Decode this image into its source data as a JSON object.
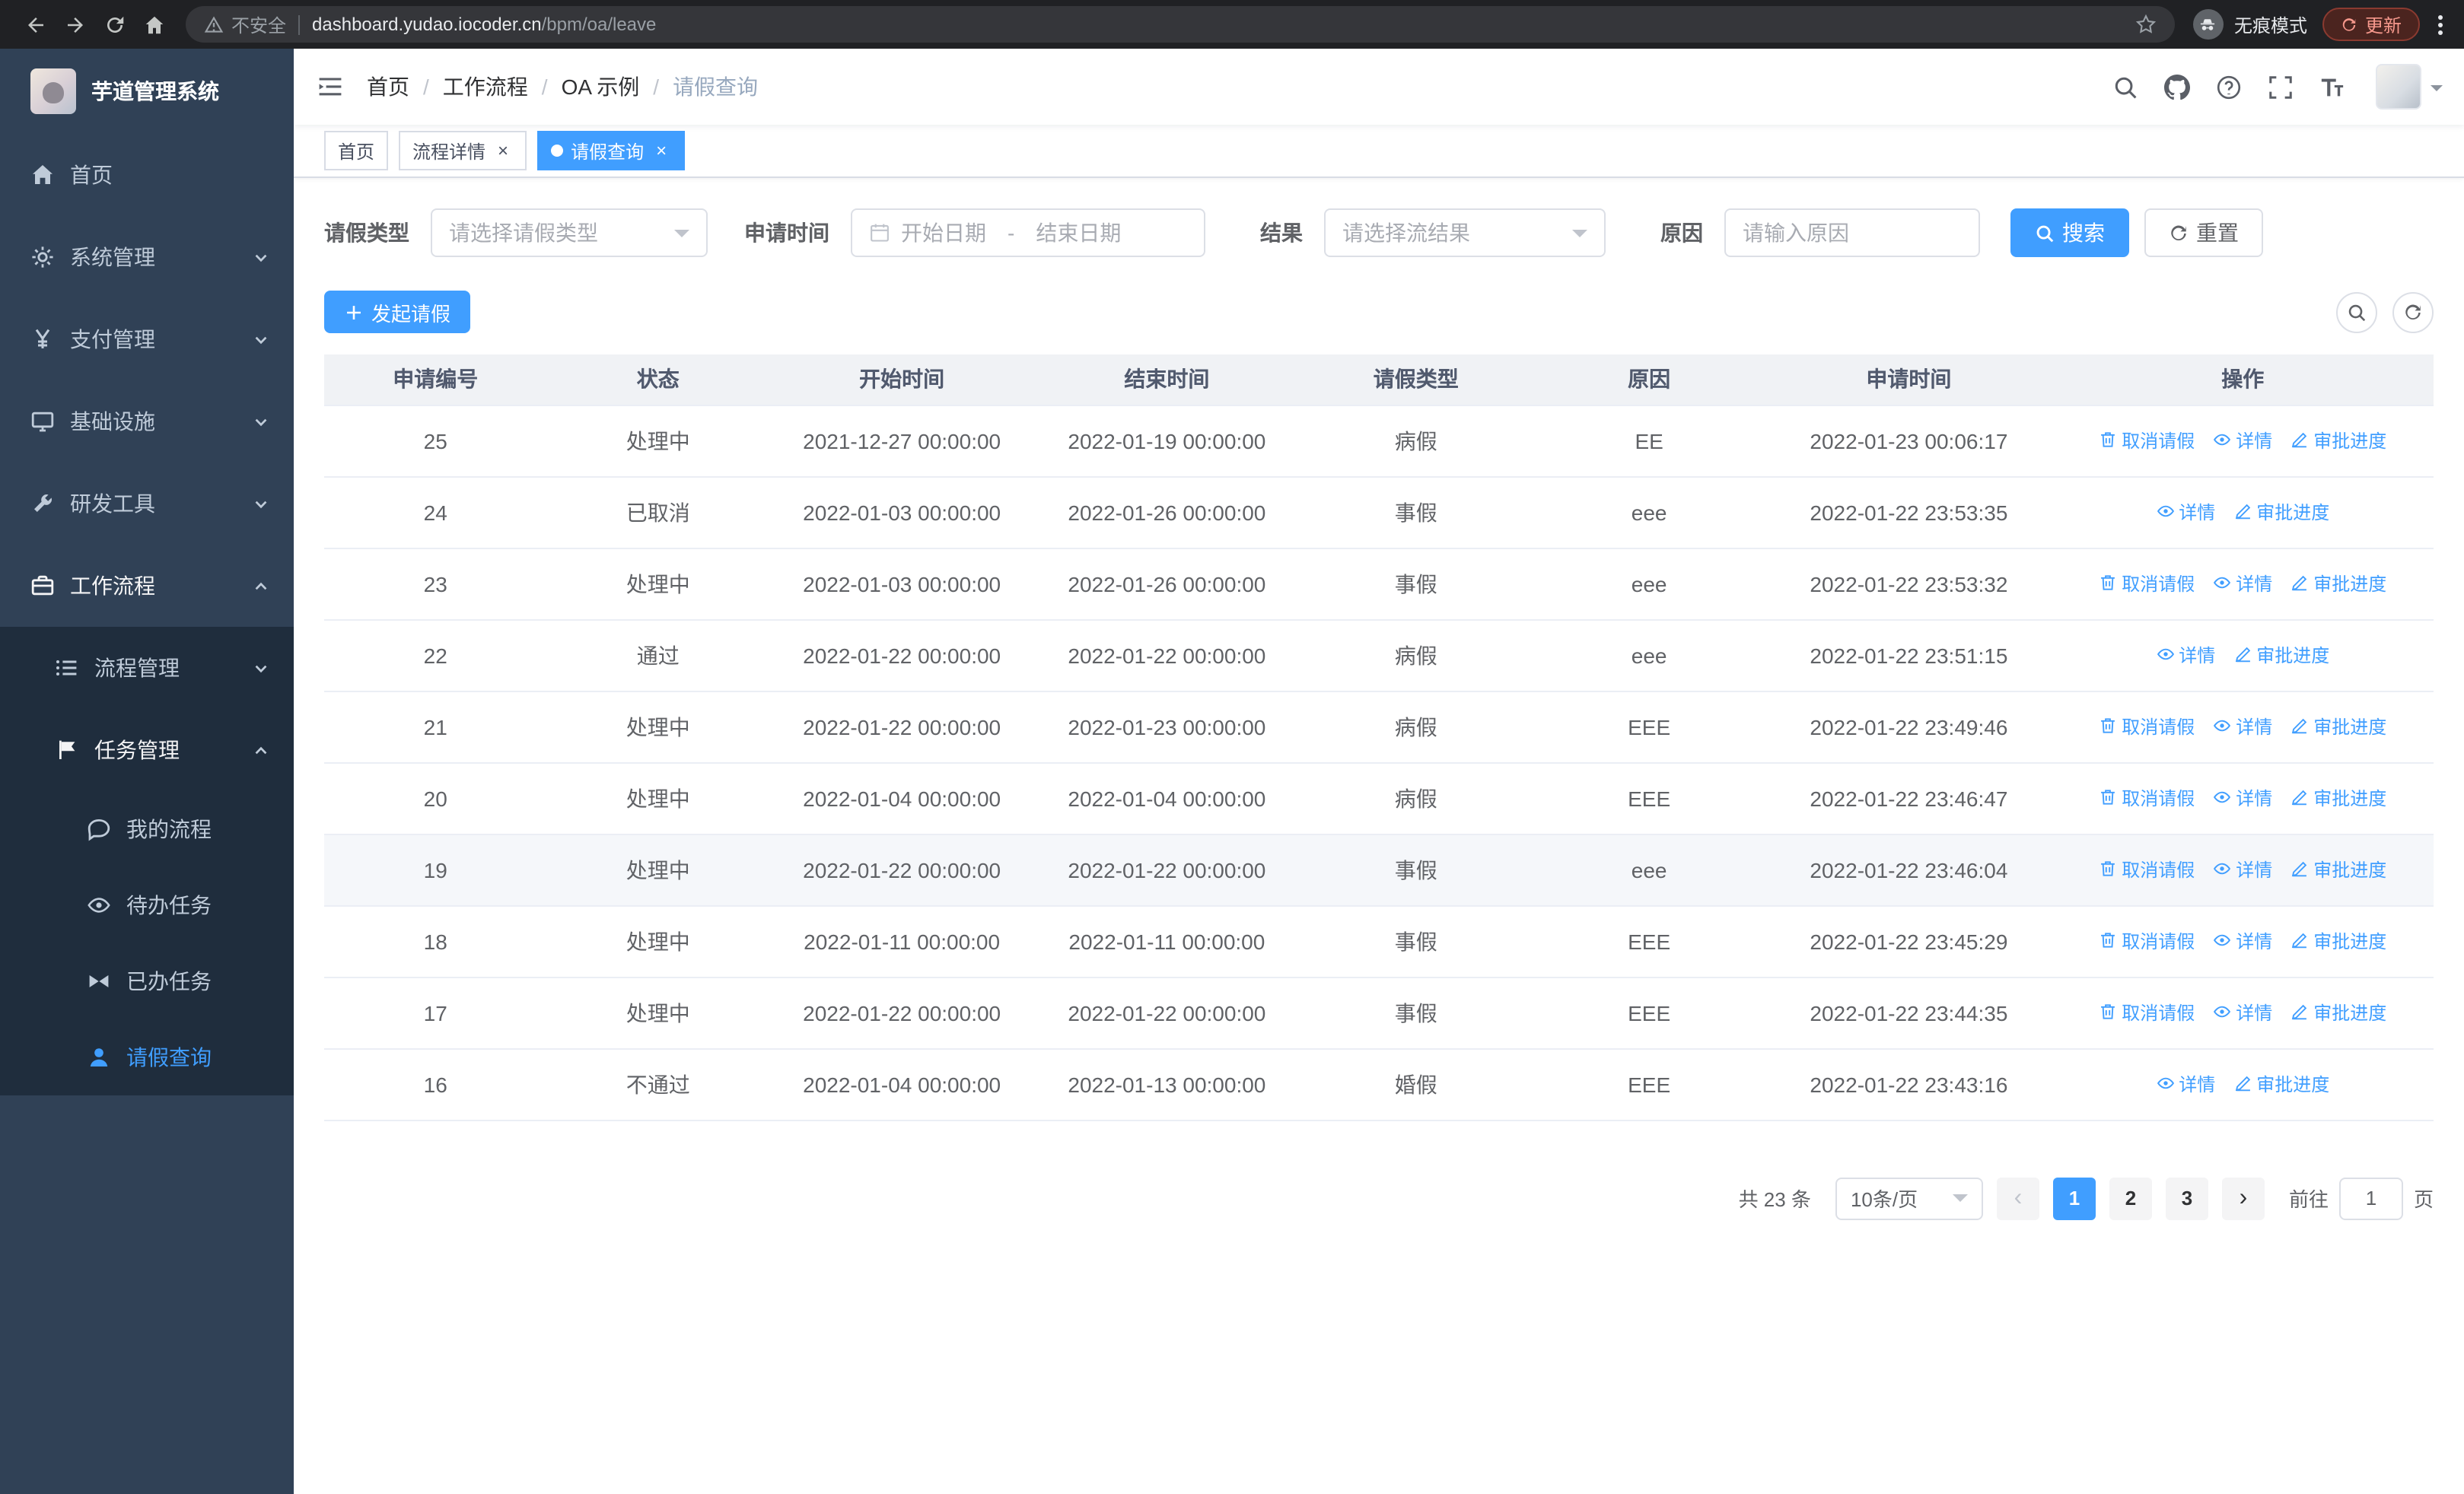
{
  "browser": {
    "security_label": "不安全",
    "url_domain": "dashboard.yudao.iocoder.cn",
    "url_path": "/bpm/oa/leave",
    "incognito_label": "无痕模式",
    "update_label": "更新"
  },
  "sidebar": {
    "title": "芋道管理系统",
    "items": [
      {
        "key": "home",
        "label": "首页",
        "icon": "home-icon",
        "level": 1,
        "expandable": false,
        "expanded": false,
        "sub": false,
        "active": false,
        "active_trail": false
      },
      {
        "key": "system",
        "label": "系统管理",
        "icon": "gear-icon",
        "level": 1,
        "expandable": true,
        "expanded": false,
        "sub": false,
        "active": false,
        "active_trail": false
      },
      {
        "key": "payment",
        "label": "支付管理",
        "icon": "yen-icon",
        "level": 1,
        "expandable": true,
        "expanded": false,
        "sub": false,
        "active": false,
        "active_trail": false
      },
      {
        "key": "infra",
        "label": "基础设施",
        "icon": "monitor-icon",
        "level": 1,
        "expandable": true,
        "expanded": false,
        "sub": false,
        "active": false,
        "active_trail": false
      },
      {
        "key": "devtools",
        "label": "研发工具",
        "icon": "tools-icon",
        "level": 1,
        "expandable": true,
        "expanded": false,
        "sub": false,
        "active": false,
        "active_trail": false
      },
      {
        "key": "workflow",
        "label": "工作流程",
        "icon": "briefcase-icon",
        "level": 1,
        "expandable": true,
        "expanded": true,
        "sub": false,
        "active": false,
        "active_trail": true
      },
      {
        "key": "process-mgmt",
        "label": "流程管理",
        "icon": "list-icon",
        "level": 2,
        "expandable": true,
        "expanded": false,
        "sub": true,
        "active": false,
        "active_trail": false
      },
      {
        "key": "task-mgmt",
        "label": "任务管理",
        "icon": "flag-icon",
        "level": 2,
        "expandable": true,
        "expanded": true,
        "sub": true,
        "active": false,
        "active_trail": true
      },
      {
        "key": "my-process",
        "label": "我的流程",
        "icon": "chat-icon",
        "level": 3,
        "expandable": false,
        "expanded": false,
        "sub": true,
        "active": false,
        "active_trail": false
      },
      {
        "key": "todo-tasks",
        "label": "待办任务",
        "icon": "eye-icon",
        "level": 3,
        "expandable": false,
        "expanded": false,
        "sub": true,
        "active": false,
        "active_trail": false
      },
      {
        "key": "done-tasks",
        "label": "已办任务",
        "icon": "bowtie-icon",
        "level": 3,
        "expandable": false,
        "expanded": false,
        "sub": true,
        "active": false,
        "active_trail": false
      },
      {
        "key": "leave-query",
        "label": "请假查询",
        "icon": "user-icon",
        "level": 3,
        "expandable": false,
        "expanded": false,
        "sub": true,
        "active": true,
        "active_trail": false
      }
    ]
  },
  "header": {
    "breadcrumb": [
      "首页",
      "工作流程",
      "OA 示例",
      "请假查询"
    ]
  },
  "tabs": [
    {
      "key": "home",
      "label": "首页",
      "closable": false,
      "active": false
    },
    {
      "key": "process-detail",
      "label": "流程详情",
      "closable": true,
      "active": false
    },
    {
      "key": "leave-query",
      "label": "请假查询",
      "closable": true,
      "active": true
    }
  ],
  "filters": {
    "leave_type_label": "请假类型",
    "leave_type_placeholder": "请选择请假类型",
    "apply_time_label": "申请时间",
    "start_date_placeholder": "开始日期",
    "range_separator": "-",
    "end_date_placeholder": "结束日期",
    "result_label": "结果",
    "result_placeholder": "请选择流结果",
    "reason_label": "原因",
    "reason_placeholder": "请输入原因",
    "search_button": "搜索",
    "reset_button": "重置"
  },
  "toolbar": {
    "create_button": "发起请假"
  },
  "table": {
    "columns": [
      "申请编号",
      "状态",
      "开始时间",
      "结束时间",
      "请假类型",
      "原因",
      "申请时间",
      "操作"
    ],
    "actions": {
      "cancel": "取消请假",
      "detail": "详情",
      "progress": "审批进度"
    },
    "rows": [
      {
        "id": "25",
        "status": "处理中",
        "start": "2021-12-27 00:00:00",
        "end": "2022-01-19 00:00:00",
        "type": "病假",
        "reason": "EE",
        "applied": "2022-01-23 00:06:17",
        "actions": [
          "cancel",
          "detail",
          "progress"
        ],
        "highlight": false
      },
      {
        "id": "24",
        "status": "已取消",
        "start": "2022-01-03 00:00:00",
        "end": "2022-01-26 00:00:00",
        "type": "事假",
        "reason": "eee",
        "applied": "2022-01-22 23:53:35",
        "actions": [
          "detail",
          "progress"
        ],
        "highlight": false
      },
      {
        "id": "23",
        "status": "处理中",
        "start": "2022-01-03 00:00:00",
        "end": "2022-01-26 00:00:00",
        "type": "事假",
        "reason": "eee",
        "applied": "2022-01-22 23:53:32",
        "actions": [
          "cancel",
          "detail",
          "progress"
        ],
        "highlight": false
      },
      {
        "id": "22",
        "status": "通过",
        "start": "2022-01-22 00:00:00",
        "end": "2022-01-22 00:00:00",
        "type": "病假",
        "reason": "eee",
        "applied": "2022-01-22 23:51:15",
        "actions": [
          "detail",
          "progress"
        ],
        "highlight": false
      },
      {
        "id": "21",
        "status": "处理中",
        "start": "2022-01-22 00:00:00",
        "end": "2022-01-23 00:00:00",
        "type": "病假",
        "reason": "EEE",
        "applied": "2022-01-22 23:49:46",
        "actions": [
          "cancel",
          "detail",
          "progress"
        ],
        "highlight": false
      },
      {
        "id": "20",
        "status": "处理中",
        "start": "2022-01-04 00:00:00",
        "end": "2022-01-04 00:00:00",
        "type": "病假",
        "reason": "EEE",
        "applied": "2022-01-22 23:46:47",
        "actions": [
          "cancel",
          "detail",
          "progress"
        ],
        "highlight": false
      },
      {
        "id": "19",
        "status": "处理中",
        "start": "2022-01-22 00:00:00",
        "end": "2022-01-22 00:00:00",
        "type": "事假",
        "reason": "eee",
        "applied": "2022-01-22 23:46:04",
        "actions": [
          "cancel",
          "detail",
          "progress"
        ],
        "highlight": true
      },
      {
        "id": "18",
        "status": "处理中",
        "start": "2022-01-11 00:00:00",
        "end": "2022-01-11 00:00:00",
        "type": "事假",
        "reason": "EEE",
        "applied": "2022-01-22 23:45:29",
        "actions": [
          "cancel",
          "detail",
          "progress"
        ],
        "highlight": false
      },
      {
        "id": "17",
        "status": "处理中",
        "start": "2022-01-22 00:00:00",
        "end": "2022-01-22 00:00:00",
        "type": "事假",
        "reason": "EEE",
        "applied": "2022-01-22 23:44:35",
        "actions": [
          "cancel",
          "detail",
          "progress"
        ],
        "highlight": false
      },
      {
        "id": "16",
        "status": "不通过",
        "start": "2022-01-04 00:00:00",
        "end": "2022-01-13 00:00:00",
        "type": "婚假",
        "reason": "EEE",
        "applied": "2022-01-22 23:43:16",
        "actions": [
          "detail",
          "progress"
        ],
        "highlight": false
      }
    ]
  },
  "pagination": {
    "total": "共 23 条",
    "page_size": "10条/页",
    "pages": [
      "1",
      "2",
      "3"
    ],
    "active_page": "1",
    "goto_label": "前往",
    "goto_value": "1",
    "page_unit": "页"
  },
  "colors": {
    "primary": "#409eff",
    "sidebar_bg": "#304156",
    "submenu_bg": "#1f2d3d",
    "table_header_bg": "#f0f2f5"
  }
}
